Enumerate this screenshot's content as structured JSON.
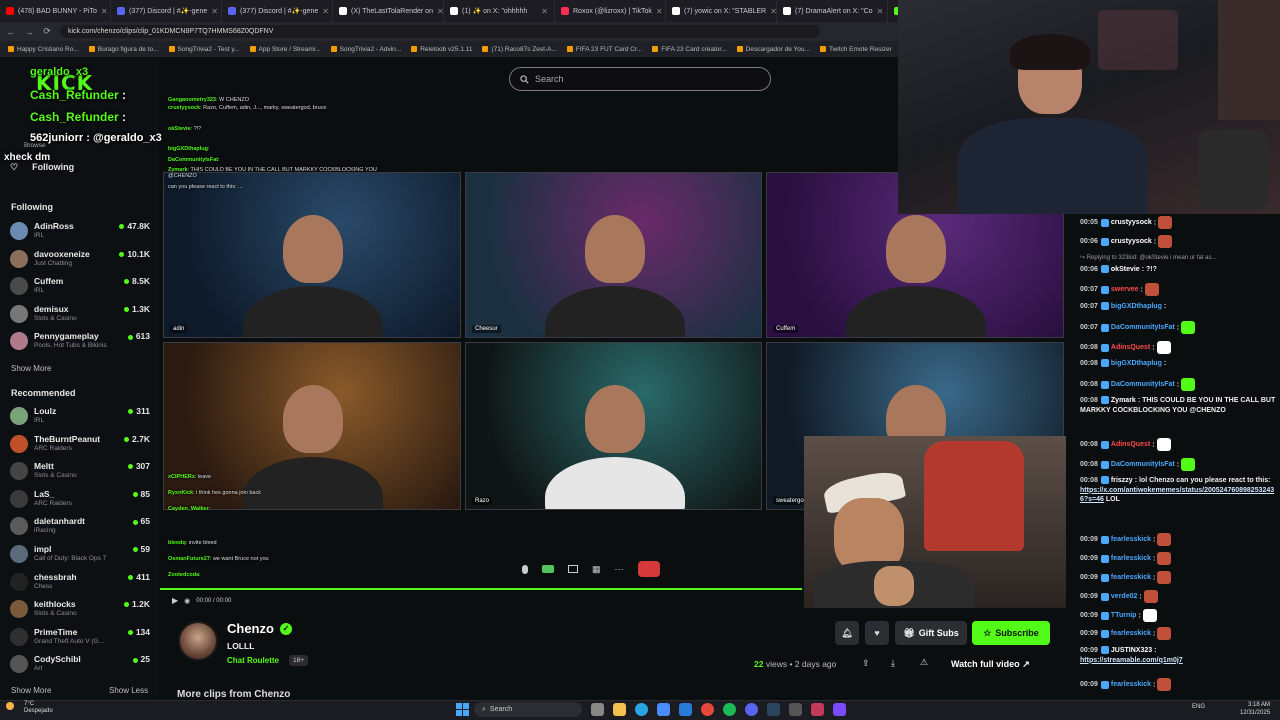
{
  "tabs": [
    {
      "label": "(478) BAD BUNNY - PiTo",
      "color": "#ff0000"
    },
    {
      "label": "(377) Discord | #✨-gene",
      "color": "#5865f2"
    },
    {
      "label": "(377) Discord | #✨-gene",
      "color": "#5865f2"
    },
    {
      "label": "(X) TheLastTolaRender on",
      "color": "#ffffff"
    },
    {
      "label": "(1) ✨ on X: \"ohhhhh",
      "color": "#ffffff"
    },
    {
      "label": "Roxox (@lizroxx) | TikTok",
      "color": "#ff2d55"
    },
    {
      "label": "(7) yowic on X: \"STABLER",
      "color": "#ffffff"
    },
    {
      "label": "(7) DramaAlert on X: \"Co",
      "color": "#ffffff"
    },
    {
      "label": "AdinRoss",
      "color": "#53fc18"
    }
  ],
  "url": "kick.com/chenzo/clips/clip_01KDMCN8P7TQ7HMMS68Z0QDFNV",
  "bookmarks": [
    "Happy Cristiano Ro...",
    "Burago figura de to...",
    "SongTrivia2 - Test y...",
    "App Store / Streami...",
    "SongTrivia2 - Advin...",
    "Reletoob v25.1.11",
    "(71) Raco87s Zest-A...",
    "FIFA 23 FUT Card Cr...",
    "FIFA 23 Card creator...",
    "Descargador de You...",
    "Twitch Emote Resizer",
    "twitch em"
  ],
  "search": {
    "placeholder": "Search"
  },
  "sidebar": {
    "browse": "Browse",
    "following_top": "Following",
    "following_heading": "Following",
    "following": [
      {
        "name": "AdinRoss",
        "category": "IRL",
        "viewers": "47.8K",
        "color": "#6b8bb5"
      },
      {
        "name": "davooxeneize",
        "category": "Just Chatting",
        "viewers": "10.1K",
        "color": "#8c6f5a"
      },
      {
        "name": "Cuffem",
        "category": "IRL",
        "viewers": "8.5K",
        "color": "#4a4a4a"
      },
      {
        "name": "demisux",
        "category": "Slots & Casino",
        "viewers": "1.3K",
        "color": "#777777"
      },
      {
        "name": "Pennygameplay",
        "category": "Pools, Hot Tubs & Bikinis",
        "viewers": "613",
        "color": "#b07a8a"
      }
    ],
    "show_more_following": "Show More",
    "recommended_heading": "Recommended",
    "recommended": [
      {
        "name": "Loulz",
        "category": "IRL",
        "viewers": "311",
        "color": "#7aa37a"
      },
      {
        "name": "TheBurntPeanut",
        "category": "ARC Raiders",
        "viewers": "2.7K",
        "color": "#c0502a"
      },
      {
        "name": "Meltt",
        "category": "Slots & Casino",
        "viewers": "307",
        "color": "#444444"
      },
      {
        "name": "LaS_",
        "category": "ARC Raiders",
        "viewers": "85",
        "color": "#3a3a3a"
      },
      {
        "name": "daletanhardt",
        "category": "iRacing",
        "viewers": "65",
        "color": "#5a5a5a"
      },
      {
        "name": "impl",
        "category": "Call of Duty: Black Ops 7",
        "viewers": "59",
        "color": "#5a6a7a"
      },
      {
        "name": "chessbrah",
        "category": "Chess",
        "viewers": "411",
        "color": "#222222"
      },
      {
        "name": "keithlocks",
        "category": "Slots & Casino",
        "viewers": "1.2K",
        "color": "#7a5a3a"
      },
      {
        "name": "PrimeTime",
        "category": "Grand Theft Auto V (G...",
        "viewers": "134",
        "color": "#2f2f2f"
      },
      {
        "name": "CodySchibl",
        "category": "Art",
        "viewers": "25",
        "color": "#555555"
      }
    ],
    "show_more_recommended": "Show More",
    "show_less": "Show Less"
  },
  "overlay_chat": [
    {
      "user": "geraldo_x3",
      "msg": ""
    },
    {
      "user": "Cash_Refunder",
      "msg": ":"
    },
    {
      "user": "Cash_Refunder",
      "msg": ":"
    },
    {
      "user": "562juniorr",
      "msg": ": @geraldo_x3"
    },
    {
      "user": "",
      "msg": "xheck dm"
    }
  ],
  "video_tiles": [
    {
      "label": "adin",
      "bg1": "#2a4a6a",
      "bg2": "#0e1a2a"
    },
    {
      "label": "Cheesur",
      "bg1": "#6a2a6a",
      "bg2": "#1a3040"
    },
    {
      "label": "Cuffem",
      "bg1": "#5a2a7a",
      "bg2": "#2a1040"
    },
    {
      "label": "",
      "bg1": "#8a5a2a",
      "bg2": "#2a1a10"
    },
    {
      "label": "Razo",
      "bg1": "#2a6a6a",
      "bg2": "#101515"
    },
    {
      "label": "sweatergod",
      "bg1": "#3a6a8a",
      "bg2": "#101a25"
    }
  ],
  "clip_small_chat": [
    {
      "user": "Ganganometry323",
      "msg": ": W CHENZO"
    },
    {
      "user": "crustyysock",
      "msg": ": Razo, Cuffem, adin, J..., marky, sweatergod, bruce"
    },
    {
      "user": "okStevie",
      "msg": ": ?!?"
    },
    {
      "user": "bigGXDthaplug",
      "msg": ":"
    },
    {
      "user": "DaCommunityIsFat",
      "msg": ":"
    },
    {
      "user": "Zymark",
      "msg": ": THIS COULD BE YOU IN THE CALL BUT MARKKY COCKBLOCKING YOU @CHENZO"
    },
    {
      "user": "",
      "msg": "can you please react to this: ..."
    },
    {
      "user": "xCIPHERx",
      "msg": ": leave"
    },
    {
      "user": "RyxnKick",
      "msg": ": i think hes gonna join back"
    },
    {
      "user": "Cayden_Walker",
      "msg": ":"
    },
    {
      "user": "bleedq",
      "msg": ": invite bleed"
    },
    {
      "user": "OsmanFuture27",
      "msg": ": we want Bruce not you"
    },
    {
      "user": "Zootedcoda",
      "msg": ":"
    }
  ],
  "player": {
    "time": "00:00 / 00:00",
    "progress": 1.0
  },
  "channel": {
    "name": "Chenzo",
    "clip_title": "LOLLL",
    "category": "Chat Roulette",
    "age": "18+",
    "views_count": "22",
    "views_suffix": "views • 2 days ago",
    "gift_subs": "Gift Subs",
    "subscribe": "Subscribe",
    "watch_full": "Watch full video",
    "more_clips": "More clips from Chenzo"
  },
  "chat": [
    {
      "time": "00:05",
      "user": "crustyysock",
      "color": "#ffffff",
      "msg": ":",
      "emote": "#c0503a"
    },
    {
      "time": "00:06",
      "user": "crustyysock",
      "color": "#ffffff",
      "msg": ":",
      "emote": "#c0503a"
    },
    {
      "reply": "Replying to 323kid: @okStevie i mean ur fat as..."
    },
    {
      "time": "00:06",
      "user": "okStevie",
      "color": "#ffffff",
      "msg": ": ?!?"
    },
    {
      "time": "00:07",
      "user": "swervee",
      "color": "#ff4a4a",
      "msg": ":",
      "emote": "#c0503a"
    },
    {
      "time": "00:07",
      "user": "bigGXDthaplug",
      "color": "#4aa8ff",
      "msg": ":"
    },
    {
      "time": "00:07",
      "user": "DaCommunityIsFat",
      "color": "#4aa8ff",
      "msg": ":",
      "emote": "#53fc18"
    },
    {
      "time": "00:08",
      "user": "AdinsQuest",
      "color": "#ff4a4a",
      "msg": ":",
      "emote": "#ffffff"
    },
    {
      "time": "00:08",
      "user": "bigGXDthaplug",
      "color": "#4aa8ff",
      "msg": ":"
    },
    {
      "time": "00:08",
      "user": "DaCommunityIsFat",
      "color": "#4aa8ff",
      "msg": ":",
      "emote": "#53fc18"
    },
    {
      "time": "00:08",
      "user": "Zymark",
      "color": "#ffffff",
      "msg": ": THIS COULD BE YOU IN THE CALL BUT MARKKY COCKBLOCKING YOU @CHENZO"
    },
    {
      "time": "00:08",
      "user": "AdinsQuest",
      "color": "#ff4a4a",
      "msg": ":",
      "emote": "#ffffff"
    },
    {
      "time": "00:08",
      "user": "DaCommunityIsFat",
      "color": "#4aa8ff",
      "msg": ":",
      "emote": "#53fc18"
    },
    {
      "time": "00:08",
      "user": "friszzy",
      "color": "#ffffff",
      "msg": ": lol Chenzo can you please react to this:",
      "link": "https://x.com/antiwokememes/status/2005247608982532436?s=46",
      "after": " LOL"
    },
    {
      "time": "00:09",
      "user": "fearlesskick",
      "color": "#4aa8ff",
      "msg": ":",
      "emote": "#c0503a"
    },
    {
      "time": "00:09",
      "user": "fearlesskick",
      "color": "#4aa8ff",
      "msg": ":",
      "emote": "#c0503a"
    },
    {
      "time": "00:09",
      "user": "fearlesskick",
      "color": "#4aa8ff",
      "msg": ":",
      "emote": "#c0503a"
    },
    {
      "time": "00:09",
      "user": "verde02",
      "color": "#4aa8ff",
      "msg": ":",
      "emote": "#c0503a"
    },
    {
      "time": "00:09",
      "user": "TTurnip",
      "color": "#4aa8ff",
      "msg": ":",
      "emote": "#ffffff"
    },
    {
      "time": "00:09",
      "user": "fearlesskick",
      "color": "#4aa8ff",
      "msg": ":",
      "emote": "#c0503a"
    },
    {
      "time": "00:09",
      "user": "JUSTINX323",
      "color": "#ffffff",
      "msg": ":",
      "link": "https://streamable.com/q1m0j7",
      "after": ""
    },
    {
      "time": "00:09",
      "user": "fearlesskick",
      "color": "#4aa8ff",
      "msg": ":",
      "emote": "#c0503a"
    }
  ],
  "taskbar": {
    "weather_temp": "7°C",
    "weather_desc": "Despejado",
    "search": "Search",
    "lang": "ENG",
    "time": "3:18 AM",
    "date": "12/31/2025"
  },
  "colors": {
    "accent": "#53fc18",
    "bg": "#0b0e0f"
  }
}
